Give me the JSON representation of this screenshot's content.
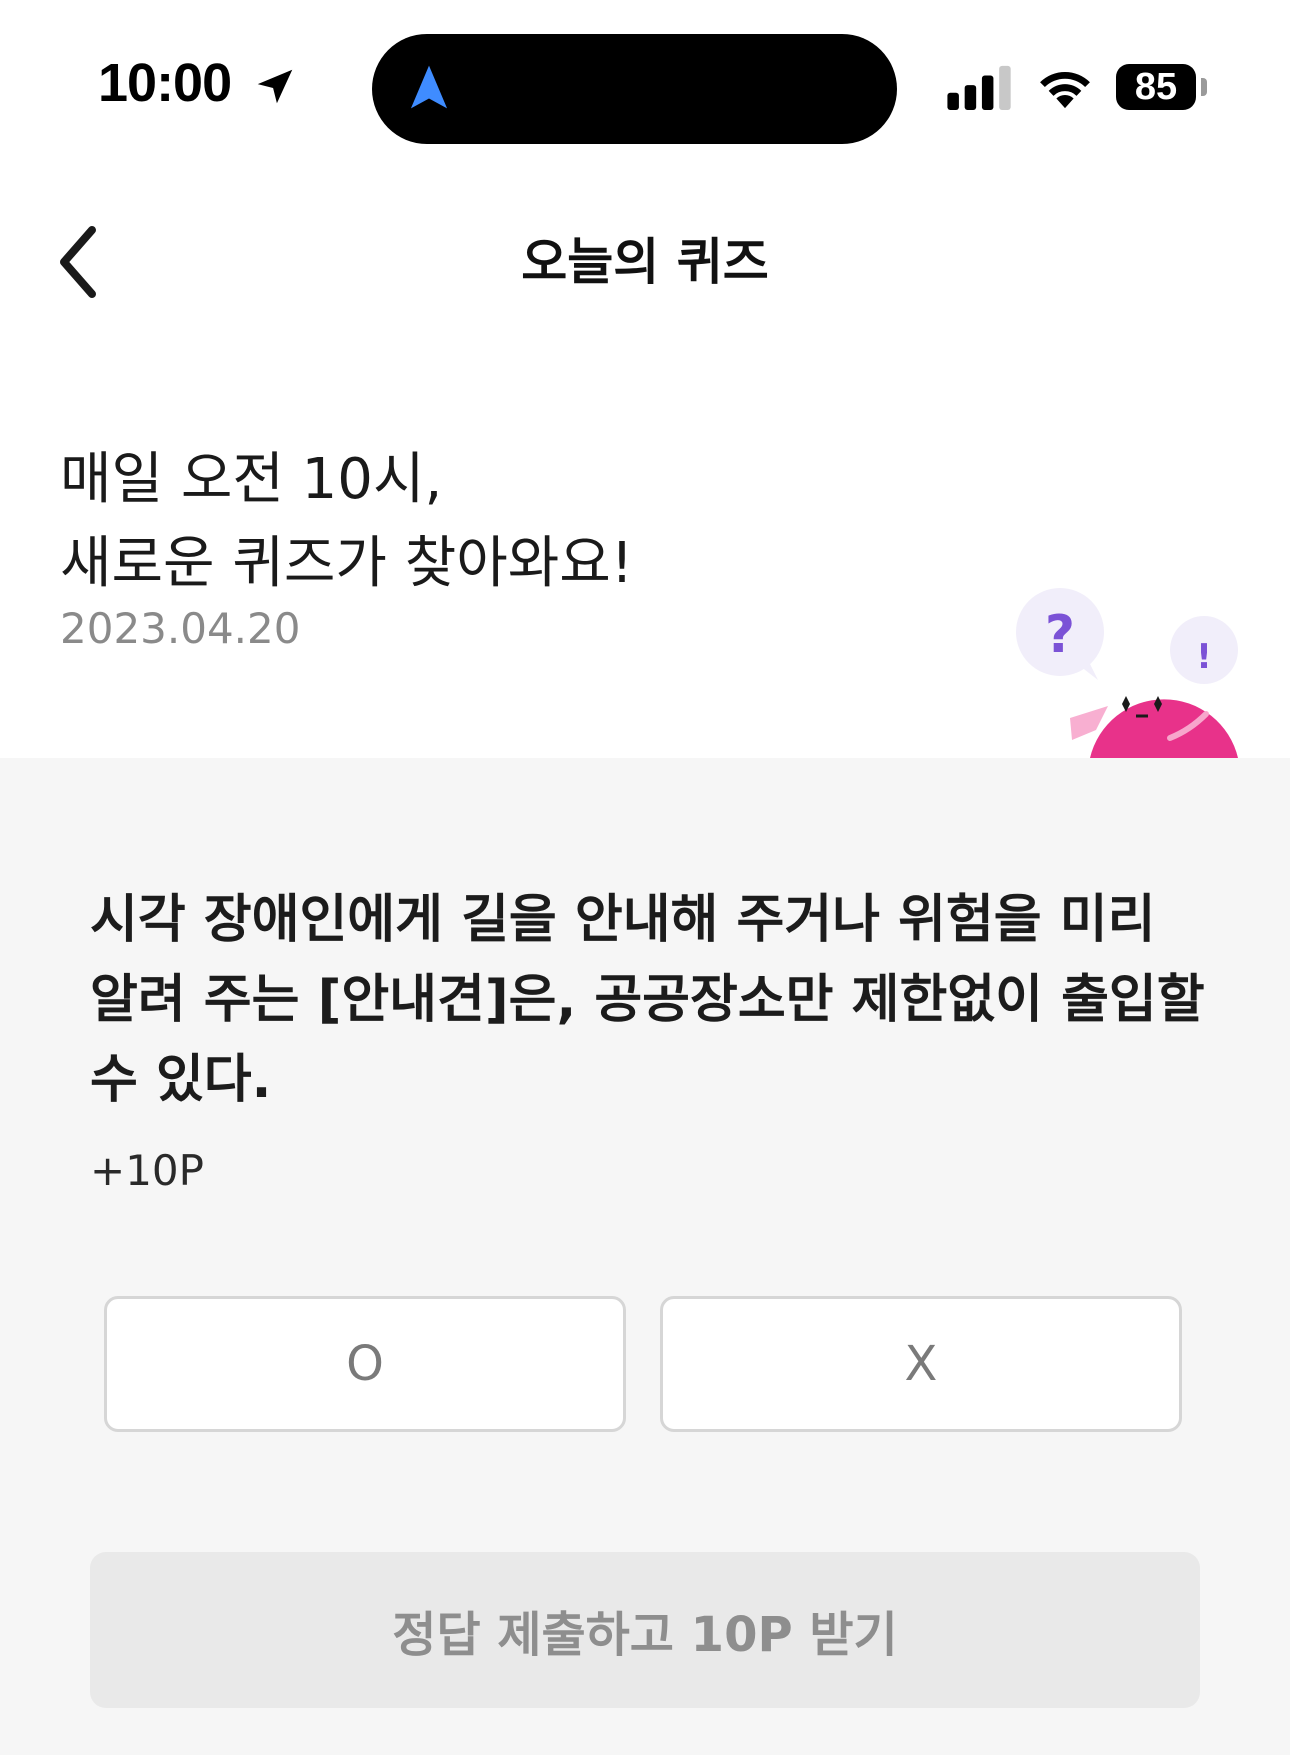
{
  "status_bar": {
    "time": "10:00",
    "battery": "85",
    "icons": [
      "location-arrow-icon",
      "navigation-icon",
      "cellular-signal-icon",
      "wifi-icon",
      "battery-icon"
    ]
  },
  "header": {
    "title": "오늘의 퀴즈",
    "back_icon": "chevron-left-icon"
  },
  "intro": {
    "line1": "매일 오전 10시,",
    "line2": "새로운 퀴즈가 찾아와요!",
    "date": "2023.04.20"
  },
  "mascot": {
    "icon": "quiz-mascot-icon",
    "bubble_question": "?",
    "bubble_exclaim": "!"
  },
  "quiz": {
    "question_line1": "시각 장애인에게 길을 안내해 주거나 위험을 미리",
    "question_line2": "알려 주는 [안내견]은, 공공장소만 제한없이 출입할",
    "question_line3": "수 있다.",
    "points": "+10P",
    "options": [
      "O",
      "X"
    ],
    "submit_label": "정답 제출하고 10P 받기"
  },
  "colors": {
    "quiz_background": "#f6f6f6",
    "mascot_pink": "#e8328a",
    "question_mark_purple": "#7b52d6",
    "nav_blue": "#3f8cff",
    "submit_disabled_bg": "#e9e9e9",
    "submit_disabled_text": "#8e8e8e"
  }
}
